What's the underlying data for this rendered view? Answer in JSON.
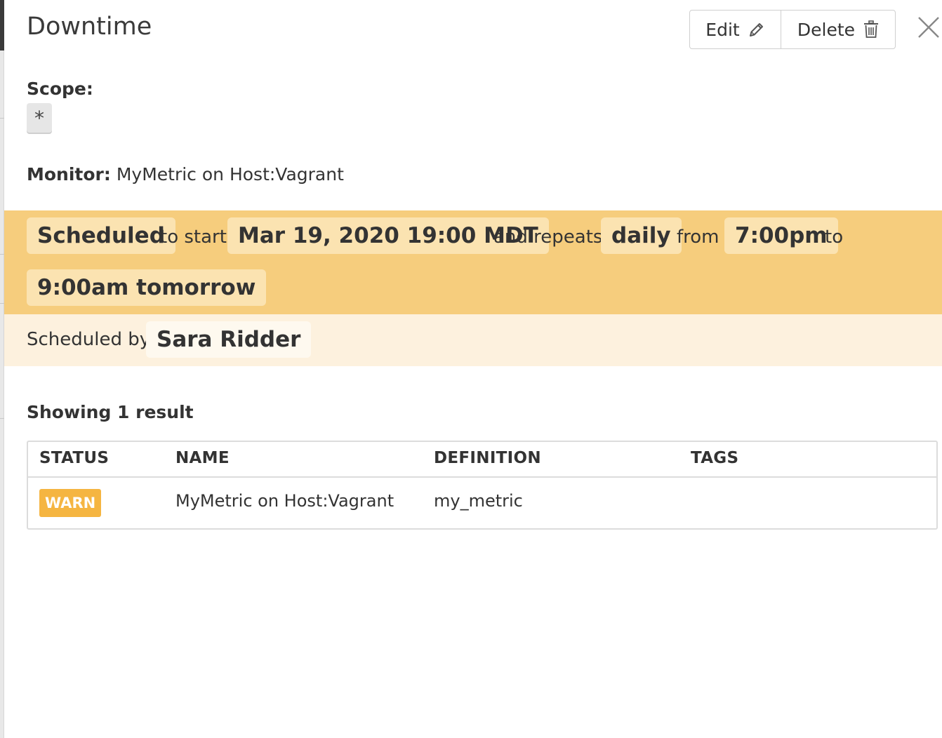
{
  "header": {
    "title": "Downtime",
    "edit_label": "Edit",
    "delete_label": "Delete"
  },
  "scope": {
    "label": "Scope:",
    "value": "*"
  },
  "monitor": {
    "label": "Monitor:",
    "value": "MyMetric on Host:Vagrant"
  },
  "schedule": {
    "status": "Scheduled",
    "to_start_text": "to start",
    "start": "Mar 19, 2020 19:00 MDT",
    "repeats_text": "and repeats",
    "frequency": "daily",
    "from_text": "from",
    "from_time": "7:00pm",
    "to_text": "to",
    "to_time": "9:00am tomorrow",
    "band_color": "#f6cd7d"
  },
  "byline": {
    "text": "Scheduled by",
    "name": "Sara Ridder"
  },
  "results": {
    "heading": "Showing 1 result",
    "columns": [
      "STATUS",
      "NAME",
      "DEFINITION",
      "TAGS"
    ],
    "rows": [
      {
        "status": "WARN",
        "name": "MyMetric on Host:Vagrant",
        "definition": "my_metric",
        "tags": ""
      }
    ],
    "warn_color": "#f5b541"
  }
}
